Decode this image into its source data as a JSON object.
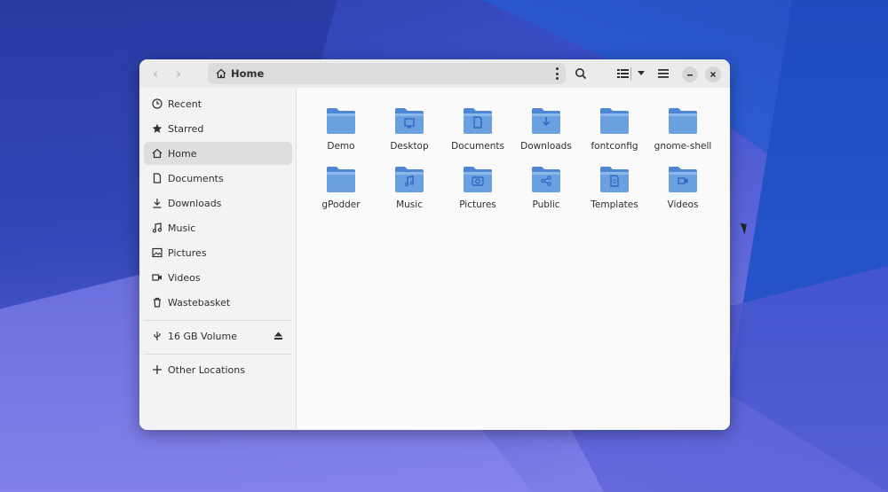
{
  "window": {
    "path_label": "Home",
    "icons": {
      "back": "chevron-left-icon",
      "forward": "chevron-right-icon",
      "search": "search-icon",
      "view": "list-view-icon",
      "view_dropdown": "chevron-down-icon",
      "menu": "hamburger-menu-icon",
      "minimize": "minimize-icon",
      "close": "close-icon"
    }
  },
  "sidebar": {
    "items": [
      {
        "label": "Recent",
        "icon": "clock-icon"
      },
      {
        "label": "Starred",
        "icon": "star-icon"
      },
      {
        "label": "Home",
        "icon": "home-icon",
        "active": true
      },
      {
        "label": "Documents",
        "icon": "document-icon"
      },
      {
        "label": "Downloads",
        "icon": "download-icon"
      },
      {
        "label": "Music",
        "icon": "music-icon"
      },
      {
        "label": "Pictures",
        "icon": "picture-icon"
      },
      {
        "label": "Videos",
        "icon": "video-icon"
      },
      {
        "label": "Wastebasket",
        "icon": "trash-icon"
      }
    ],
    "volume": {
      "label": "16 GB Volume",
      "icon": "usb-icon",
      "eject_icon": "eject-icon"
    },
    "other": {
      "label": "Other Locations",
      "icon": "plus-icon"
    }
  },
  "files": [
    {
      "name": "Demo",
      "emblem": "none"
    },
    {
      "name": "Desktop",
      "emblem": "desktop"
    },
    {
      "name": "Documents",
      "emblem": "document"
    },
    {
      "name": "Downloads",
      "emblem": "download"
    },
    {
      "name": "fontconfig",
      "emblem": "none"
    },
    {
      "name": "gnome-shell",
      "emblem": "none"
    },
    {
      "name": "gPodder",
      "emblem": "none"
    },
    {
      "name": "Music",
      "emblem": "music"
    },
    {
      "name": "Pictures",
      "emblem": "camera"
    },
    {
      "name": "Public",
      "emblem": "share"
    },
    {
      "name": "Templates",
      "emblem": "template"
    },
    {
      "name": "Videos",
      "emblem": "video"
    }
  ],
  "colors": {
    "folder": "#6a9fe0",
    "folder_dark": "#4f86d4",
    "accent_text": "#2e2e2e"
  }
}
